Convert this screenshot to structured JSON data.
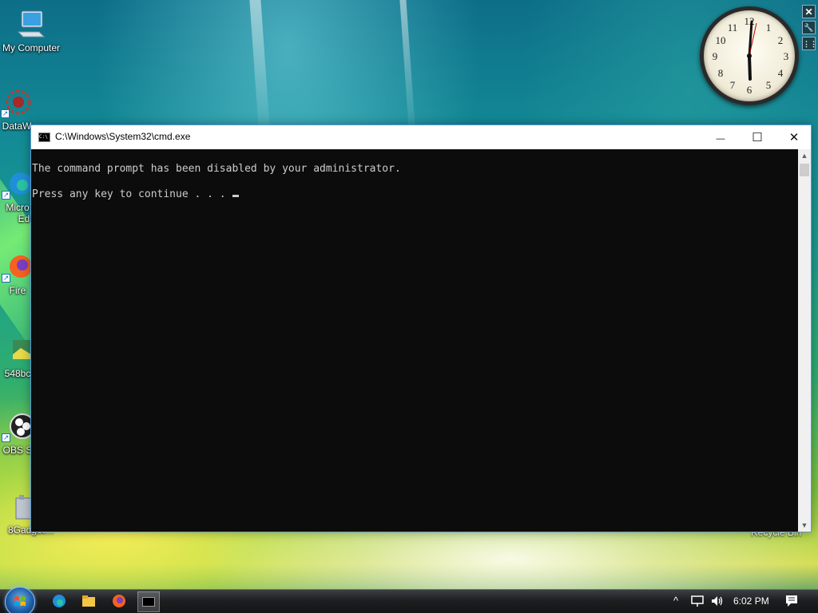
{
  "desktop": {
    "icons": [
      {
        "label": "My Computer",
        "icon": "computer-icon"
      },
      {
        "label": "DataW",
        "icon": "datawave-icon"
      },
      {
        "label": "Micro",
        "label2": "Ed",
        "icon": "edge-icon"
      },
      {
        "label": "Fire",
        "icon": "firefox-icon"
      },
      {
        "label": "548bc",
        "icon": "image-file-icon"
      },
      {
        "label": "OBS S",
        "icon": "obs-icon"
      },
      {
        "label": "8Gadget…",
        "icon": "gadget-pack-icon"
      }
    ],
    "recycle_bin": "Recycle Bin"
  },
  "clock_gadget": {
    "numbers": [
      "12",
      "1",
      "2",
      "3",
      "4",
      "5",
      "6",
      "7",
      "8",
      "9",
      "10",
      "11"
    ],
    "time": "6:02"
  },
  "gadget_controls": {
    "close_symbol": "✕",
    "settings_symbol": "🔧",
    "drag_symbol": "⋮⋮"
  },
  "cmd": {
    "title": "C:\\Windows\\System32\\cmd.exe",
    "icon_text": "C:\\",
    "minimize_symbol": "—",
    "maximize_symbol": "☐",
    "close_symbol": "✕",
    "lines": [
      "The command prompt has been disabled by your administrator.",
      "Press any key to continue . . . "
    ],
    "background_color": "#0c0c0c",
    "text_color": "#cccccc"
  },
  "taskbar": {
    "pinned": [
      {
        "name": "edge",
        "icon": "edge-icon"
      },
      {
        "name": "file-explorer",
        "icon": "folder-icon"
      },
      {
        "name": "firefox",
        "icon": "firefox-icon"
      },
      {
        "name": "cmd",
        "icon": "cmd-icon"
      }
    ],
    "tray": {
      "chevron": "^",
      "time": "6:02 PM"
    }
  }
}
